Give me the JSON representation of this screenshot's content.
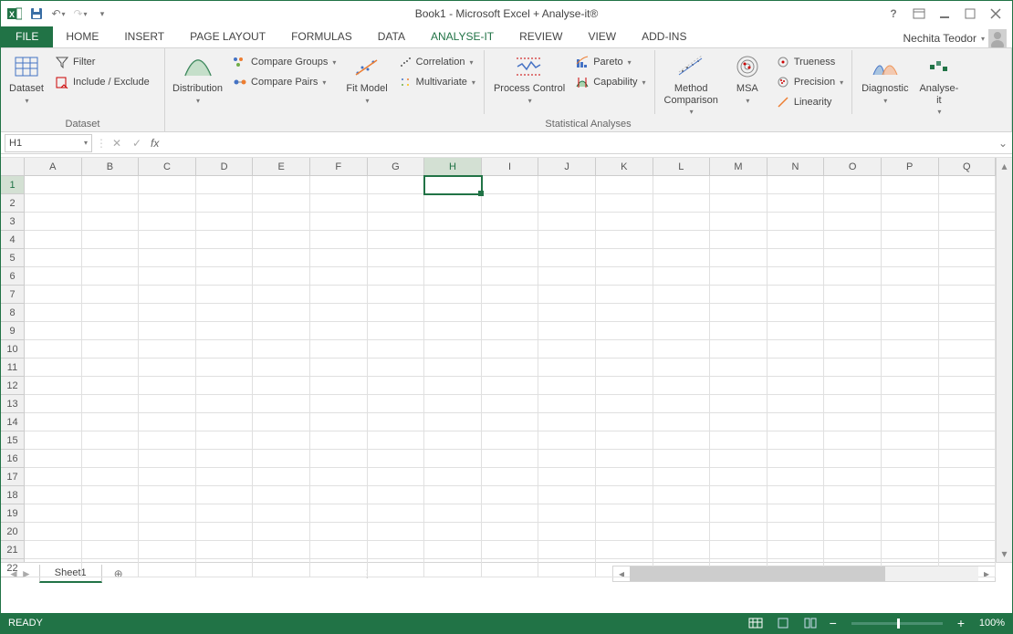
{
  "title": "Book1 - Microsoft Excel + Analyse-it®",
  "user_name": "Nechita Teodor",
  "tabs": {
    "file": "FILE",
    "list": [
      "HOME",
      "INSERT",
      "PAGE LAYOUT",
      "FORMULAS",
      "DATA",
      "ANALYSE-IT",
      "REVIEW",
      "VIEW",
      "ADD-INS"
    ],
    "active": "ANALYSE-IT"
  },
  "ribbon": {
    "dataset_group": {
      "label": "Dataset",
      "dataset_btn": "Dataset",
      "filter_btn": "Filter",
      "include_exclude_btn": "Include / Exclude"
    },
    "stats_group": {
      "label": "Statistical Analyses",
      "distribution_btn": "Distribution",
      "compare_groups": "Compare Groups",
      "compare_pairs": "Compare Pairs",
      "fit_model_btn": "Fit Model",
      "correlation": "Correlation",
      "multivariate": "Multivariate",
      "process_control_btn": "Process Control",
      "pareto": "Pareto",
      "capability": "Capability",
      "method_comparison_btn": "Method\nComparison",
      "msa_btn": "MSA",
      "trueness": "Trueness",
      "precision": "Precision",
      "linearity": "Linearity",
      "diagnostic_btn": "Diagnostic",
      "analyse_it_btn": "Analyse-\nit"
    }
  },
  "formula": {
    "name_box": "H1",
    "fx_label": "fx",
    "input": ""
  },
  "grid": {
    "columns": [
      "A",
      "B",
      "C",
      "D",
      "E",
      "F",
      "G",
      "H",
      "I",
      "J",
      "K",
      "L",
      "M",
      "N",
      "O",
      "P",
      "Q"
    ],
    "rows": [
      1,
      2,
      3,
      4,
      5,
      6,
      7,
      8,
      9,
      10,
      11,
      12,
      13,
      14,
      15,
      16,
      17,
      18,
      19,
      20,
      21,
      22
    ],
    "selected_col": "H",
    "selected_row": 1
  },
  "sheets": {
    "active": "Sheet1"
  },
  "status": {
    "ready": "READY",
    "zoom": "100%"
  }
}
